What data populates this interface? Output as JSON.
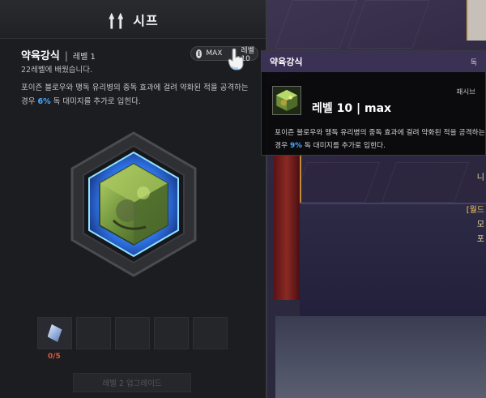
{
  "panel": {
    "title": "시프",
    "icon": "twin-daggers-icon"
  },
  "skill": {
    "name": "약육강식",
    "separator": "|",
    "level": "레벨 1",
    "learned_text": "22레벨에 배웠습니다.",
    "max_toggle": "MAX",
    "max_level_text": "레벨 10",
    "desc_before": "포이즌 블로우와 맹독 유리병의 중독 효과에 걸려 약화된 적을 공격하는 경우 ",
    "desc_pct": "6%",
    "desc_after": " 독 대미지를 추가로 입힌다.",
    "accent_color": "#4aa8ff"
  },
  "slots": {
    "count_text": "0/5",
    "count_color": "#e0553c",
    "item_icon": "crystal-gem-icon"
  },
  "upgrade": {
    "label": "레벨 2 업그레이드"
  },
  "tooltip": {
    "title": "약육강식",
    "corner": "독",
    "type": "패시브",
    "level": "레벨 10 | max",
    "desc_before": "포이즌 블로우와 맹독 유리병의 중독 효과에 걸려 약화된 적을 공격하는 경우 ",
    "desc_pct": "9%",
    "desc_after": " 독 대미지를 추가로 입힌다."
  },
  "world": {
    "edge_labels": [
      "니",
      "[월드",
      "모",
      "포"
    ]
  }
}
